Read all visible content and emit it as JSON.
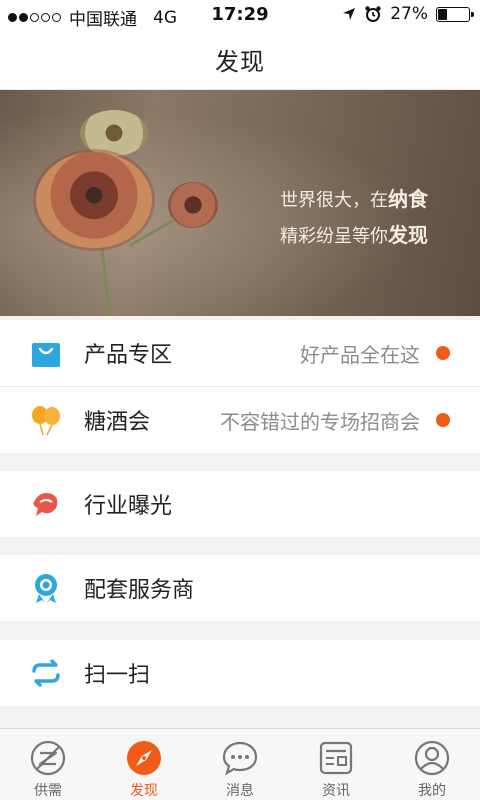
{
  "status_bar": {
    "carrier": "中国联通",
    "network": "4G",
    "time": "17:29",
    "battery": "27%",
    "battery_level": 0.27
  },
  "nav": {
    "title": "发现"
  },
  "banner": {
    "line1_prefix": "世界很大，在",
    "line1_emphasis": "纳食",
    "line2_prefix": "精彩纷呈等你",
    "line2_emphasis": "发现"
  },
  "menu": [
    {
      "label": "产品专区",
      "hint": "好产品全在这",
      "icon": "shopping-bag-icon",
      "badge": true
    },
    {
      "label": "糖酒会",
      "hint": "不容错过的专场招商会",
      "icon": "balloons-icon",
      "badge": true
    },
    {
      "label": "行业曝光",
      "icon": "megaphone-icon"
    },
    {
      "label": "配套服务商",
      "icon": "award-ribbon-icon"
    },
    {
      "label": "扫一扫",
      "icon": "scan-icon"
    }
  ],
  "tabs": [
    {
      "label": "供需",
      "icon": "supply-demand-icon"
    },
    {
      "label": "发现",
      "icon": "compass-icon",
      "active": true
    },
    {
      "label": "消息",
      "icon": "chat-bubble-icon"
    },
    {
      "label": "资讯",
      "icon": "news-icon"
    },
    {
      "label": "我的",
      "icon": "profile-icon"
    }
  ],
  "colors": {
    "accent": "#f25a1a",
    "badge": "#f25a1a",
    "icon_blue": "#2ea7e0",
    "icon_orange": "#f5a623",
    "icon_red": "#e8574a"
  }
}
